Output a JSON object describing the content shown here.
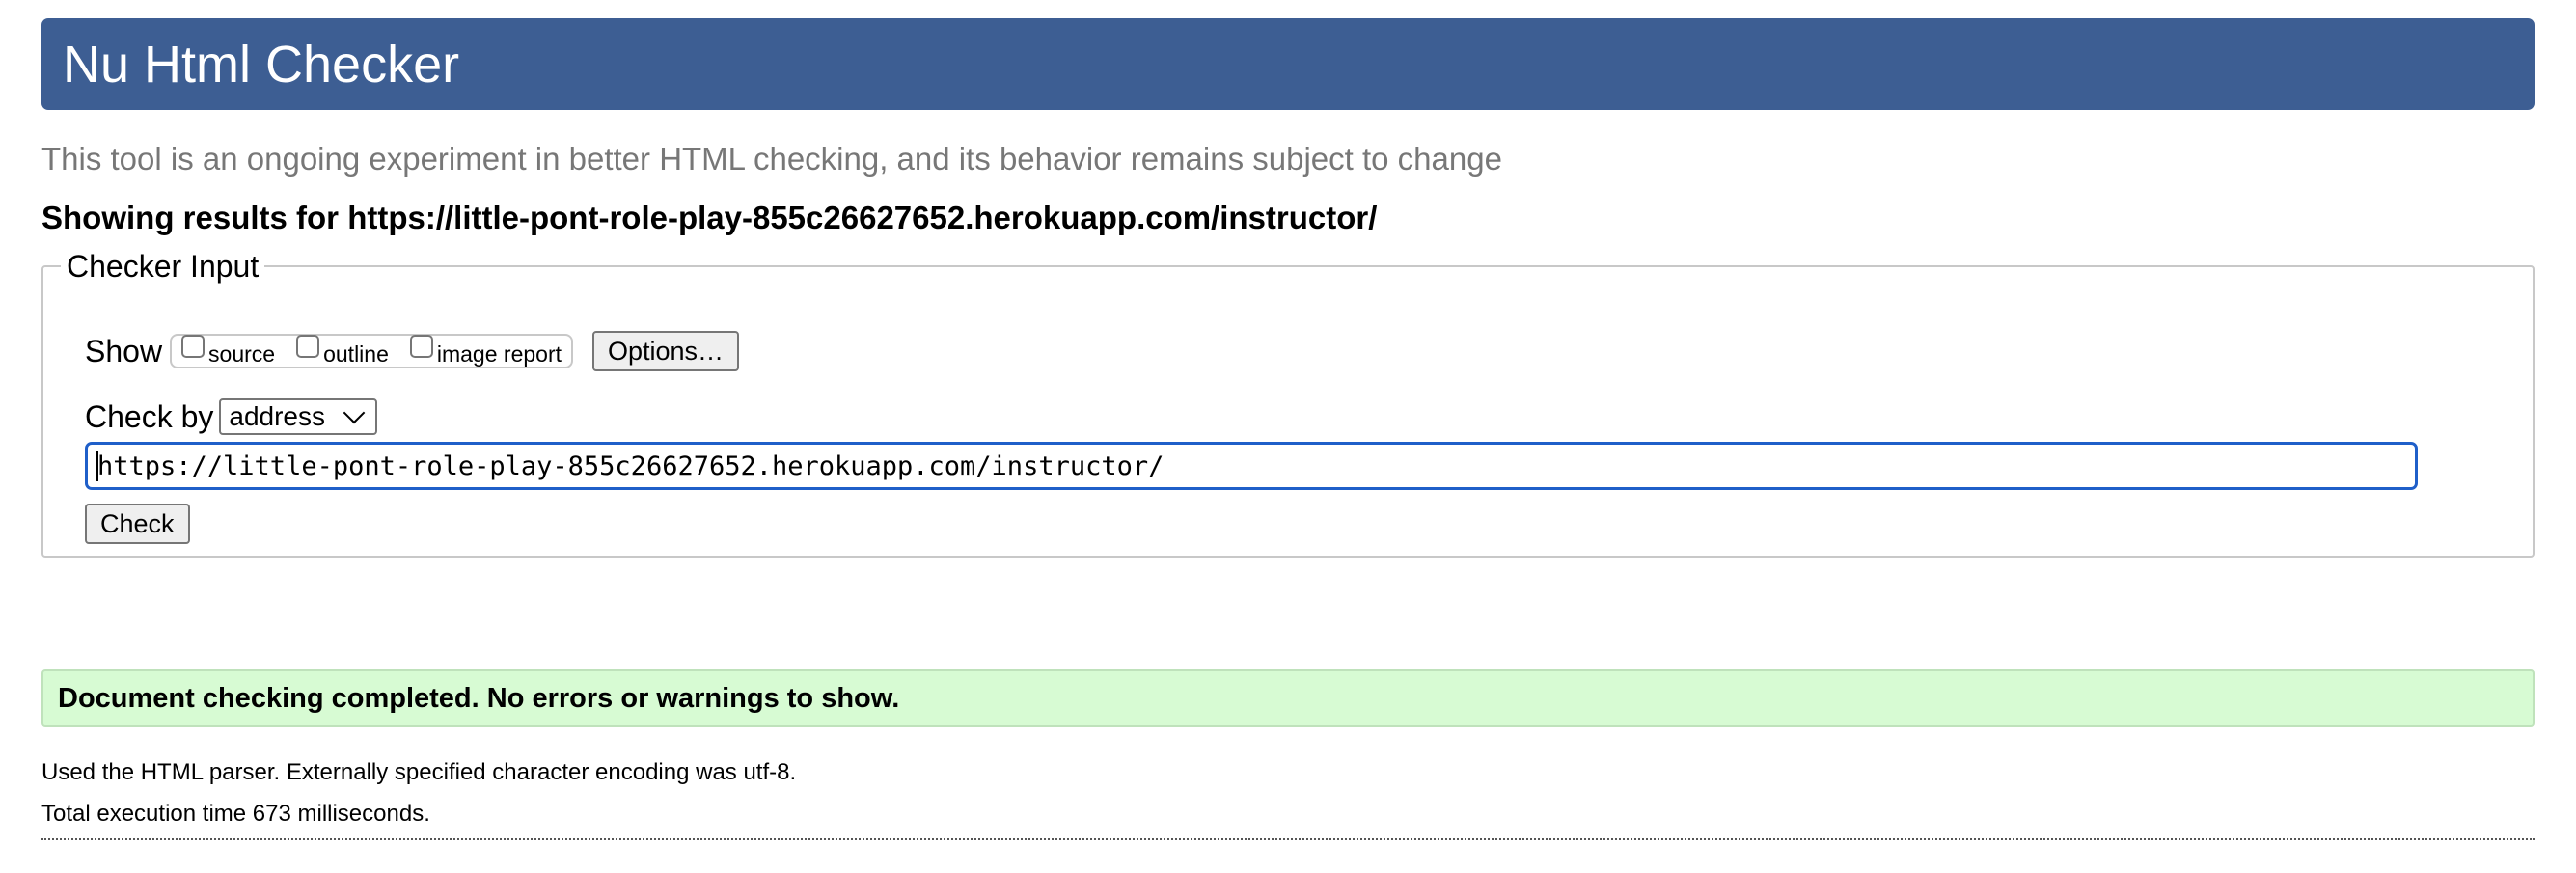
{
  "header": {
    "title": "Nu Html Checker"
  },
  "subtitle": "This tool is an ongoing experiment in better HTML checking, and its behavior remains subject to change",
  "results_for": "Showing results for https://little-pont-role-play-855c26627652.herokuapp.com/instructor/",
  "checker_input": {
    "legend": "Checker Input",
    "show_label": "Show",
    "checkboxes": [
      {
        "label": "source",
        "checked": false
      },
      {
        "label": "outline",
        "checked": false
      },
      {
        "label": "image report",
        "checked": false
      }
    ],
    "options_button": "Options…",
    "check_by_label": "Check by",
    "check_by_value": "address",
    "url_value": "https://little-pont-role-play-855c26627652.herokuapp.com/instructor/",
    "check_button": "Check"
  },
  "result": {
    "message": "Document checking completed. No errors or warnings to show.",
    "parser_info": "Used the HTML parser. Externally specified character encoding was utf-8.",
    "execution_time": "Total execution time 673 milliseconds."
  },
  "colors": {
    "banner": "#3d5e93",
    "success_bg": "#d7fbd3",
    "input_focus": "#1f5fc9"
  }
}
